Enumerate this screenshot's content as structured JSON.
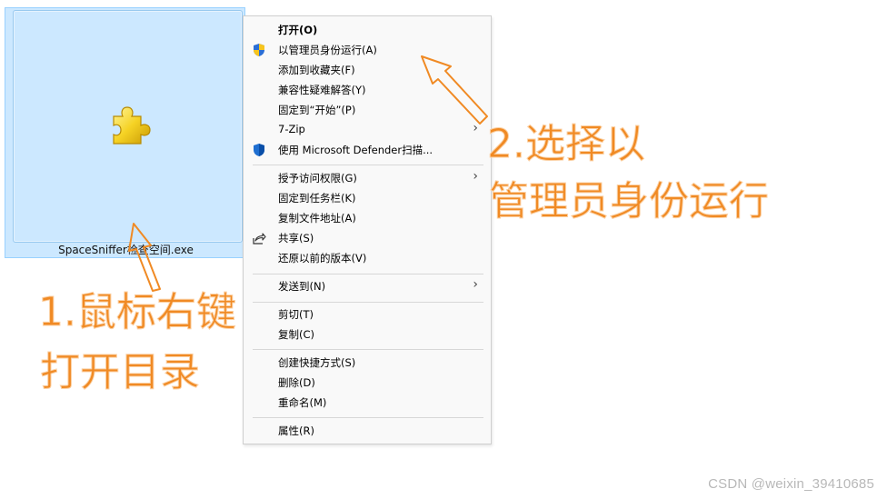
{
  "file": {
    "name": "SpaceSniffer检查空间.exe",
    "icon": "puzzle-icon"
  },
  "menu": {
    "items": [
      {
        "label": "打开(O)",
        "bold": true
      },
      {
        "label": "以管理员身份运行(A)",
        "icon": "uac-shield-icon"
      },
      {
        "label": "添加到收藏夹(F)"
      },
      {
        "label": "兼容性疑难解答(Y)"
      },
      {
        "label": "固定到“开始”(P)"
      },
      {
        "label": "7-Zip",
        "submenu": true
      },
      {
        "label": "使用 Microsoft Defender扫描...",
        "icon": "defender-shield-icon"
      },
      {
        "label": "授予访问权限(G)",
        "submenu": true
      },
      {
        "label": "固定到任务栏(K)"
      },
      {
        "label": "复制文件地址(A)"
      },
      {
        "label": "共享(S)",
        "icon": "share-icon"
      },
      {
        "label": "还原以前的版本(V)"
      },
      {
        "label": "发送到(N)",
        "submenu": true
      },
      {
        "label": "剪切(T)"
      },
      {
        "label": "复制(C)"
      },
      {
        "label": "创建快捷方式(S)"
      },
      {
        "label": "删除(D)"
      },
      {
        "label": "重命名(M)"
      },
      {
        "label": "属性(R)"
      }
    ],
    "submenu_glyph": "›"
  },
  "annotations": {
    "step1_line1": "1.鼠标右键",
    "step1_line2": "打开目录",
    "step2_line1": "2.选择以",
    "step2_line2": "管理员身份运行"
  },
  "colors": {
    "annotation": "#f08a24",
    "selection": "#cce8ff"
  },
  "watermark": "CSDN @weixin_39410685"
}
